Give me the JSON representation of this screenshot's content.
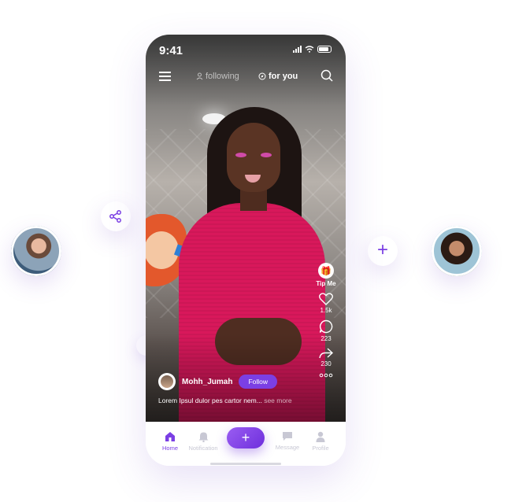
{
  "status_bar": {
    "time": "9:41"
  },
  "top_nav": {
    "tabs": [
      {
        "label": "following",
        "active": false
      },
      {
        "label": "for you",
        "active": true
      }
    ]
  },
  "actions": {
    "tip_label": "Tip Me",
    "likes": "1.5k",
    "comments": "223",
    "shares": "230"
  },
  "post": {
    "username": "Mohh_Jumah",
    "follow_label": "Follow",
    "caption": "Lorem Ipsul dulor pes cartor nem...",
    "see_more": "see more"
  },
  "bottom_nav": {
    "items": [
      {
        "label": "Home",
        "active": true
      },
      {
        "label": "Notification",
        "active": false
      },
      {
        "label": "+",
        "active": false
      },
      {
        "label": "Message",
        "active": false
      },
      {
        "label": "Profile",
        "active": false
      }
    ]
  },
  "colors": {
    "accent": "#7B3FE4",
    "inactive": "#c8c8d4"
  }
}
